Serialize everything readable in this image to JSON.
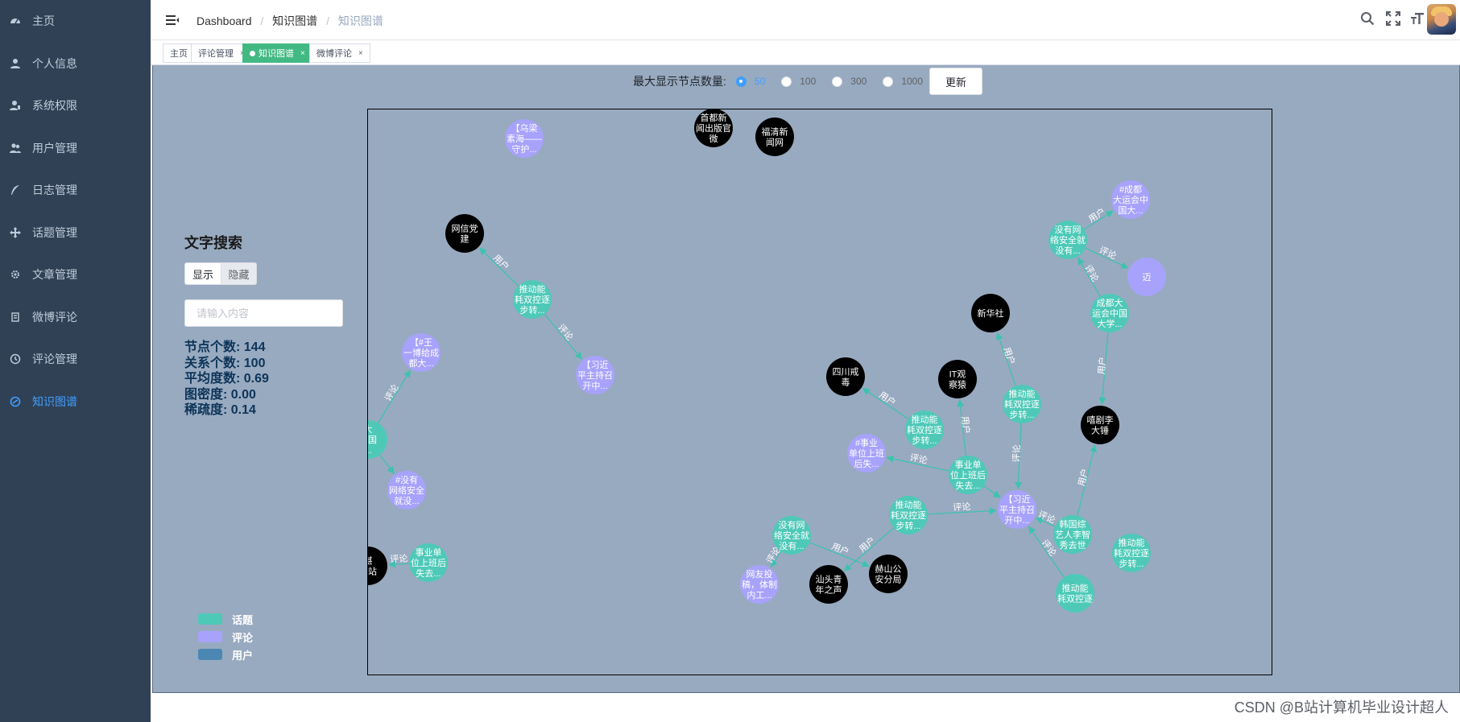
{
  "sidebar": {
    "items": [
      {
        "label": "主页",
        "icon": "dashboard-icon"
      },
      {
        "label": "个人信息",
        "icon": "user-icon"
      },
      {
        "label": "系统权限",
        "icon": "permission-icon"
      },
      {
        "label": "用户管理",
        "icon": "users-icon"
      },
      {
        "label": "日志管理",
        "icon": "feather-icon"
      },
      {
        "label": "话题管理",
        "icon": "move-icon"
      },
      {
        "label": "文章管理",
        "icon": "gear-icon"
      },
      {
        "label": "微博评论",
        "icon": "document-icon"
      },
      {
        "label": "评论管理",
        "icon": "clock-icon"
      },
      {
        "label": "知识图谱",
        "icon": "graph-icon"
      }
    ],
    "active_index": 9
  },
  "header": {
    "breadcrumb": [
      "Dashboard",
      "知识图谱",
      "知识图谱"
    ]
  },
  "tags": [
    {
      "label": "主页",
      "closable": false,
      "active": false
    },
    {
      "label": "评论管理",
      "closable": true,
      "active": false
    },
    {
      "label": "知识图谱",
      "closable": true,
      "active": true
    },
    {
      "label": "微博评论",
      "closable": true,
      "active": false
    }
  ],
  "controls": {
    "label": "最大显示节点数量:",
    "options": [
      "50",
      "100",
      "300",
      "1000"
    ],
    "selected": "50",
    "update_label": "更新"
  },
  "search": {
    "title": "文字搜索",
    "show_label": "显示",
    "hide_label": "隐藏",
    "placeholder": "请输入内容"
  },
  "stats": {
    "node_count": "节点个数:  144",
    "relation_count": "关系个数:  100",
    "avg_degree": "平均度数:  0.69",
    "density": "图密度:  0.00",
    "sparsity": "稀疏度:  0.14"
  },
  "legend": {
    "items": [
      {
        "label": "话题",
        "color": "#4ec9b8"
      },
      {
        "label": "评论",
        "color": "#a7a2fb"
      },
      {
        "label": "用户",
        "color": "#4a88b3"
      }
    ]
  },
  "graph": {
    "colors": {
      "topic": "#4ec9b8",
      "comment": "#a7a2fb",
      "user": "#000000",
      "edge": "#3ec2b0",
      "edge_label": "#ffffff"
    },
    "nodes": [
      {
        "id": "n1",
        "type": "comment",
        "lines": [
          "【乌梁",
          "素海——",
          "守护..."
        ]
      },
      {
        "id": "n2",
        "type": "user",
        "lines": [
          "首都新",
          "闻出版官",
          "微"
        ]
      },
      {
        "id": "n3",
        "type": "user",
        "lines": [
          "福清新",
          "闻网"
        ]
      },
      {
        "id": "n4",
        "type": "comment",
        "lines": [
          "#成都",
          "大运会中",
          "国大..."
        ]
      },
      {
        "id": "n5",
        "type": "topic",
        "lines": [
          "没有网",
          "络安全就",
          "没有..."
        ]
      },
      {
        "id": "n6",
        "type": "comment",
        "lines": [
          "迈"
        ]
      },
      {
        "id": "n7",
        "type": "user",
        "lines": [
          "网信党",
          "建"
        ]
      },
      {
        "id": "n8",
        "type": "topic",
        "lines": [
          "推动能",
          "耗双控逐",
          "步转..."
        ]
      },
      {
        "id": "n9",
        "type": "comment",
        "lines": [
          "【习近",
          "平主持召",
          "开中..."
        ]
      },
      {
        "id": "n10",
        "type": "topic",
        "lines": [
          "成都大",
          "运会中国",
          "大学..."
        ]
      },
      {
        "id": "n11",
        "type": "user",
        "lines": [
          "新华社"
        ]
      },
      {
        "id": "n12",
        "type": "comment",
        "lines": [
          "【#王",
          "一博给成",
          "都大..."
        ]
      },
      {
        "id": "n13",
        "type": "user",
        "lines": [
          "四川戒",
          "毒"
        ]
      },
      {
        "id": "n14",
        "type": "user",
        "lines": [
          "IT观",
          "察猿"
        ]
      },
      {
        "id": "n15",
        "type": "topic",
        "lines": [
          "推动能",
          "耗双控逐",
          "步转..."
        ]
      },
      {
        "id": "n16",
        "type": "user",
        "lines": [
          "嘻剧李",
          "大锤"
        ]
      },
      {
        "id": "n17",
        "type": "topic",
        "lines": [
          "推动能",
          "耗双控逐",
          "步转..."
        ]
      },
      {
        "id": "n18",
        "type": "topic",
        "lines": [
          "大",
          "中国",
          "..."
        ]
      },
      {
        "id": "n19",
        "type": "comment",
        "lines": [
          "#事业",
          "单位上班",
          "后失..."
        ]
      },
      {
        "id": "n20",
        "type": "topic",
        "lines": [
          "事业单",
          "位上班后",
          "失去..."
        ]
      },
      {
        "id": "n21",
        "type": "comment",
        "lines": [
          "#没有",
          "网络安全",
          "就没..."
        ]
      },
      {
        "id": "n22",
        "type": "topic",
        "lines": [
          "推动能",
          "耗双控逐",
          "步转..."
        ]
      },
      {
        "id": "n23",
        "type": "comment",
        "lines": [
          "【习近",
          "平主持召",
          "开中..."
        ]
      },
      {
        "id": "n24",
        "type": "topic",
        "lines": [
          "韩国综",
          "艺人李智",
          "秀去世"
        ]
      },
      {
        "id": "n25",
        "type": "topic",
        "lines": [
          "推动能",
          "耗双控逐",
          "步转..."
        ]
      },
      {
        "id": "n26",
        "type": "topic",
        "lines": [
          "没有网",
          "络安全就",
          "没有..."
        ]
      },
      {
        "id": "n27",
        "type": "user",
        "lines": [
          "赫山公",
          "安分局"
        ]
      },
      {
        "id": "n28",
        "type": "user",
        "lines": [
          "汕头青",
          "年之声"
        ]
      },
      {
        "id": "n29",
        "type": "topic",
        "lines": [
          "事业单",
          "位上班后",
          "失去..."
        ]
      },
      {
        "id": "n30",
        "type": "user",
        "lines": [
          "湛",
          "车站"
        ]
      },
      {
        "id": "n31",
        "type": "comment",
        "lines": [
          "网友投",
          "稿，体制",
          "内工..."
        ]
      },
      {
        "id": "n32",
        "type": "topic",
        "lines": [
          "推动能",
          "耗双控逐"
        ]
      }
    ],
    "edges": [
      {
        "from": "n8",
        "to": "n7",
        "label": "用户"
      },
      {
        "from": "n8",
        "to": "n9",
        "label": "评论"
      },
      {
        "from": "n5",
        "to": "n4",
        "label": "用户"
      },
      {
        "from": "n5",
        "to": "n6",
        "label": "评论"
      },
      {
        "from": "n10",
        "to": "n5",
        "label": "评论"
      },
      {
        "from": "n10",
        "to": "n16",
        "label": "用户"
      },
      {
        "from": "n15",
        "to": "n13",
        "label": "用户"
      },
      {
        "from": "n20",
        "to": "n14",
        "label": "用户"
      },
      {
        "from": "n20",
        "to": "n19",
        "label": "评论"
      },
      {
        "from": "n20",
        "to": "n23",
        "label": ""
      },
      {
        "from": "n17",
        "to": "n11",
        "label": "用户"
      },
      {
        "from": "n17",
        "to": "n23",
        "label": "评论"
      },
      {
        "from": "n22",
        "to": "n23",
        "label": "评论"
      },
      {
        "from": "n22",
        "to": "n28",
        "label": "用户"
      },
      {
        "from": "n26",
        "to": "n27",
        "label": "用户"
      },
      {
        "from": "n24",
        "to": "n16",
        "label": "用户"
      },
      {
        "from": "n24",
        "to": "n23",
        "label": "评论"
      },
      {
        "from": "n32",
        "to": "n23",
        "label": "评论"
      },
      {
        "from": "n18",
        "to": "n12",
        "label": "评论"
      },
      {
        "from": "n18",
        "to": "n21",
        "label": ""
      },
      {
        "from": "n29",
        "to": "n30",
        "label": "评论"
      },
      {
        "from": "n26",
        "to": "n31",
        "label": "评论"
      }
    ]
  },
  "watermark": "CSDN @B站计算机毕业设计超人"
}
